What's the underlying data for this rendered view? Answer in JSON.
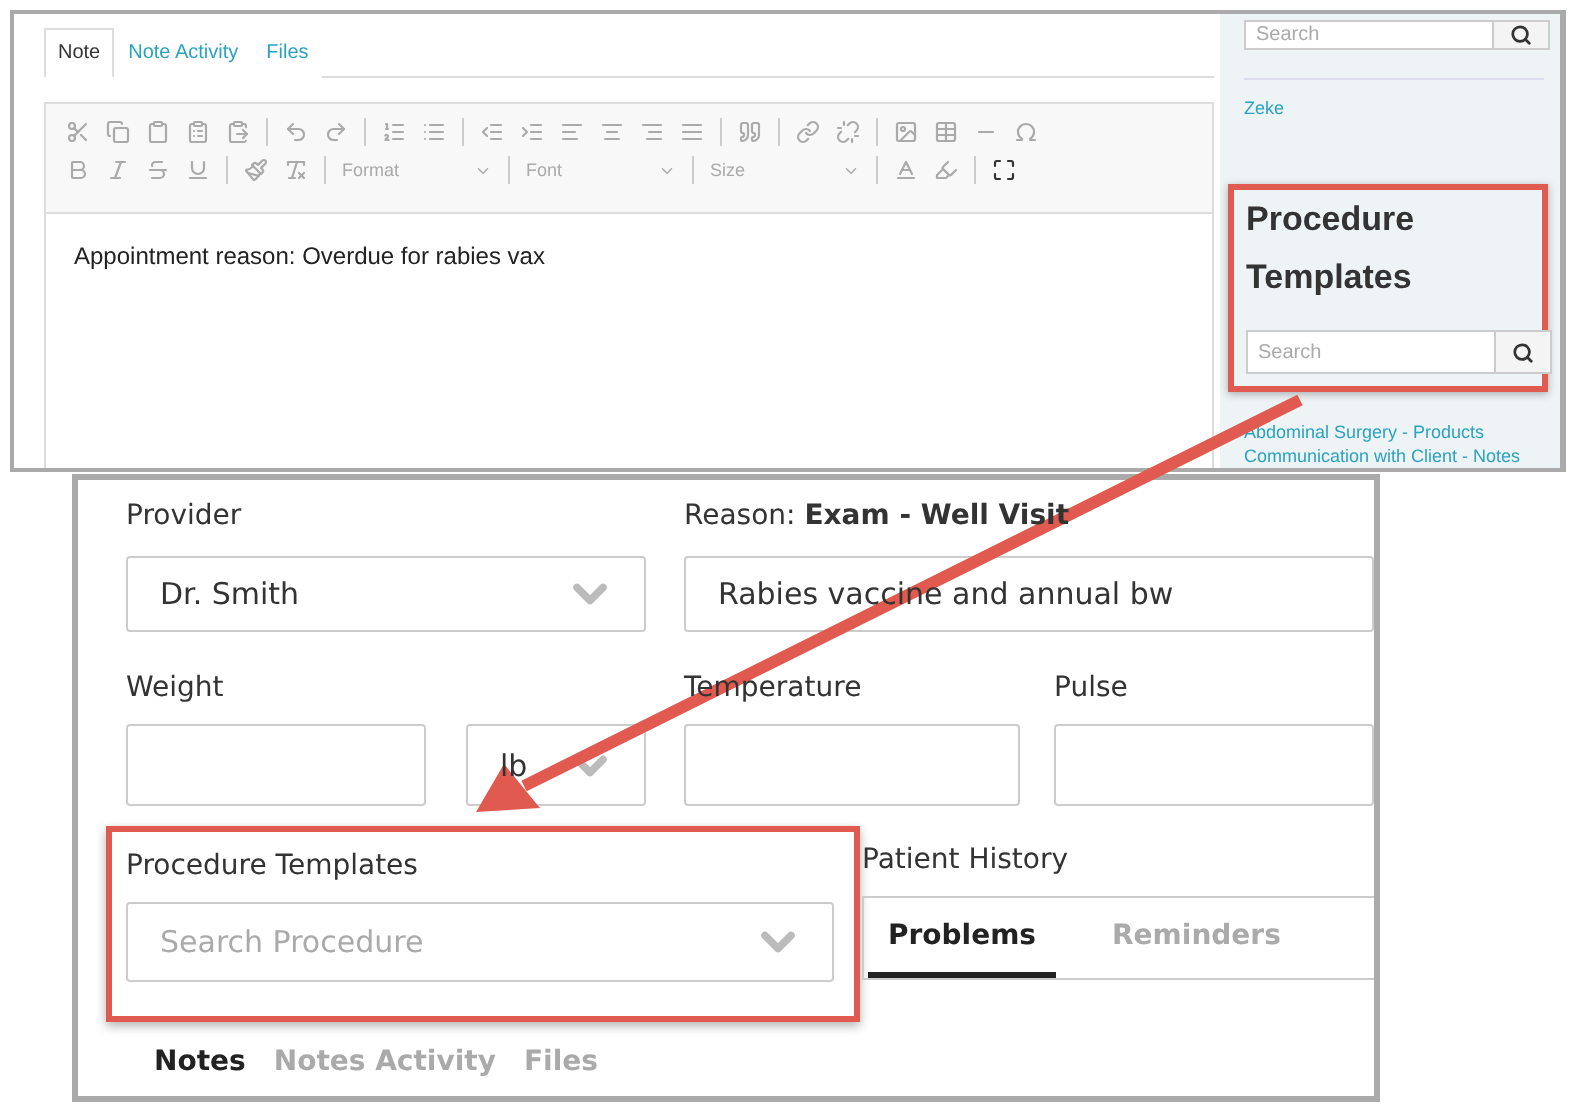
{
  "editor_panel": {
    "tabs": [
      {
        "label": "Note",
        "selected": true
      },
      {
        "label": "Note Activity",
        "selected": false
      },
      {
        "label": "Files",
        "selected": false
      }
    ],
    "toolbar": {
      "format": "Format",
      "font": "Font",
      "size": "Size"
    },
    "content": "Appointment reason: Overdue for rabies vax"
  },
  "sidebar": {
    "search": {
      "placeholder": "Search"
    },
    "links": [
      "Zeke"
    ],
    "heading": "Procedure Templates",
    "highlighted": true,
    "template_search": {
      "placeholder": "Search"
    },
    "templates": [
      "Abdominal Surgery - Products",
      "Communication with Client - Notes"
    ]
  },
  "visit_form": {
    "provider": {
      "label": "Provider",
      "value": "Dr. Smith"
    },
    "reason": {
      "label": "Reason: **Exam - Well Visit**",
      "value": "Rabies vaccine and annual bw"
    },
    "weight": {
      "label": "Weight",
      "unit": "lb"
    },
    "temperature": {
      "label": "Temperature"
    },
    "pulse": {
      "label": "Pulse"
    },
    "procedure_templates": {
      "label": "Procedure Templates",
      "placeholder": "Search Procedure",
      "highlighted": true
    },
    "patient_history": {
      "label": "Patient History",
      "tabs": [
        {
          "label": "Problems",
          "selected": true
        },
        {
          "label": "Reminders",
          "selected": false
        }
      ]
    },
    "note_tabs": [
      {
        "label": "Notes",
        "selected": true
      },
      {
        "label": "Notes Activity",
        "selected": false
      },
      {
        "label": "Files",
        "selected": false
      }
    ]
  },
  "annotation": {
    "arrow": true
  }
}
